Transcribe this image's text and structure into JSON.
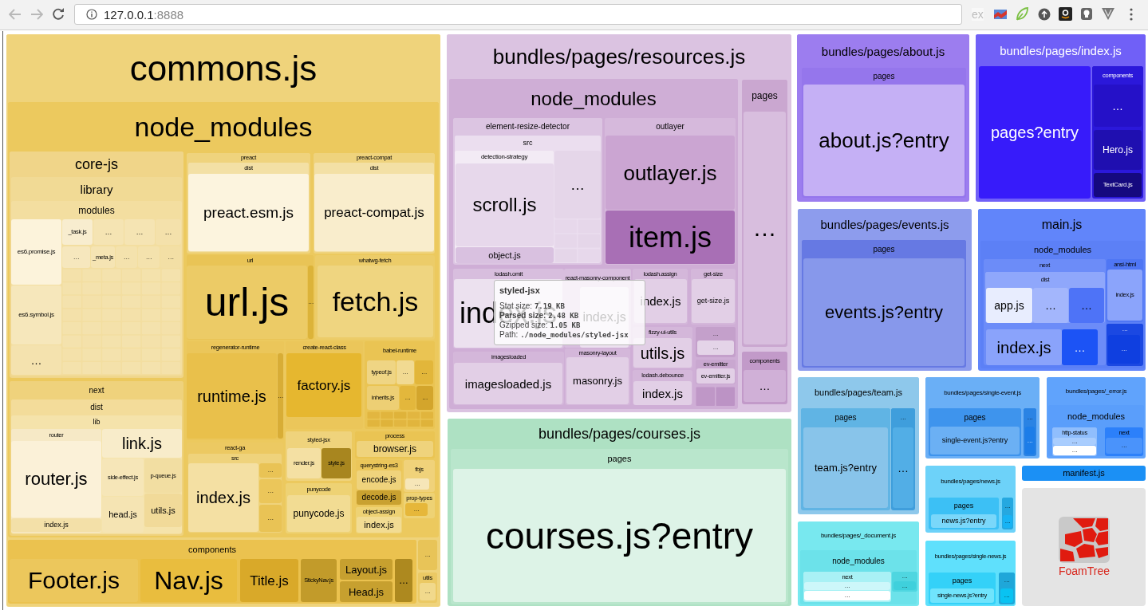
{
  "browser": {
    "url_host": "127.0.0.1",
    "url_port": ":8888",
    "extension_label": "ex"
  },
  "treemap": [
    {
      "label": "commons.js",
      "color": "#efd37b",
      "children": [
        {
          "label": "node_modules",
          "color": "#ecc95e",
          "children": [
            {
              "label": "core-js",
              "color": "#f0d589",
              "children": [
                {
                  "label": "library",
                  "color": "#f1da95",
                  "children": [
                    {
                      "label": "modules",
                      "color": "#f3dea0",
                      "children": [
                        {
                          "label": "es6.promise.js",
                          "color": "#fcf3db"
                        },
                        {
                          "label": "es6.symbol.js",
                          "color": "#f6e7bb"
                        },
                        {
                          "label": "…",
                          "color": "#f4e2ae"
                        },
                        {
                          "label": "_task.js",
                          "color": "#f8edcf"
                        },
                        {
                          "label": "…",
                          "color": "#f5e4b3"
                        },
                        {
                          "label": "…",
                          "color": "#f5e4b3"
                        },
                        {
                          "label": "…",
                          "color": "#f4e1ab"
                        },
                        {
                          "label": "…",
                          "color": "#f6e7bd"
                        },
                        {
                          "label": "_meta.js",
                          "color": "#f5e4b3"
                        },
                        {
                          "label": "…",
                          "color": "#f4e2ad"
                        },
                        {
                          "label": "…",
                          "color": "#f4e2ad"
                        },
                        {
                          "label": "…",
                          "color": "#f3dfa5"
                        }
                      ]
                    }
                  ]
                }
              ]
            },
            {
              "label": "preact",
              "color": "#efd37d",
              "children": [
                {
                  "label": "dist",
                  "color": "#f3e0a5",
                  "children": [
                    {
                      "label": "preact.esm.js",
                      "color": "#fcf4de"
                    }
                  ]
                }
              ]
            },
            {
              "label": "preact-compat",
              "color": "#efd37d",
              "children": [
                {
                  "label": "dist",
                  "color": "#f3e0a5",
                  "children": [
                    {
                      "label": "preact-compat.js",
                      "color": "#f9edcc"
                    }
                  ]
                }
              ]
            },
            {
              "label": "url",
              "color": "#e9c456",
              "children": [
                {
                  "label": "url.js",
                  "color": "#eccb66"
                },
                {
                  "label": "…",
                  "color": "#dcb339"
                }
              ]
            },
            {
              "label": "whatwg-fetch",
              "color": "#eccc69",
              "children": [
                {
                  "label": "fetch.js",
                  "color": "#efd580"
                }
              ]
            },
            {
              "label": "regenerator-runtime",
              "color": "#ebc65a",
              "children": [
                {
                  "label": "runtime.js",
                  "color": "#e9c04b"
                },
                {
                  "label": "…",
                  "color": "#d8ad36"
                }
              ]
            },
            {
              "label": "create-react-class",
              "color": "#ebc65a",
              "children": [
                {
                  "label": "factory.js",
                  "color": "#e6b72f"
                }
              ]
            },
            {
              "label": "babel-runtime",
              "color": "#eac453",
              "children": [
                {
                  "label": "typeof.js",
                  "color": "#efd584"
                },
                {
                  "label": "…",
                  "color": "#f1da92"
                },
                {
                  "label": "…",
                  "color": "#e2b63a"
                },
                {
                  "label": "inherits.js",
                  "color": "#edcf74"
                },
                {
                  "label": "…",
                  "color": "#e3b73c"
                },
                {
                  "label": "…",
                  "color": "#d3a52c"
                }
              ]
            },
            {
              "label": "next",
              "color": "#efd27c",
              "children": [
                {
                  "label": "dist",
                  "color": "#f3dc9a",
                  "children": [
                    {
                      "label": "lib",
                      "color": "#f5e3ab",
                      "children": [
                        {
                          "label": "router",
                          "color": "#f6e9c6",
                          "children": [
                            {
                              "label": "router.js",
                              "color": "#fbf1d8"
                            },
                            {
                              "label": "index.js",
                              "color": "#f3e0a8"
                            }
                          ]
                        },
                        {
                          "label": "link.js",
                          "color": "#f8ecca"
                        },
                        {
                          "label": "side-effect.js",
                          "color": "#f6e6b8"
                        },
                        {
                          "label": "p-queue.js",
                          "color": "#f2dea2"
                        },
                        {
                          "label": "head.js",
                          "color": "#f5e4b3"
                        },
                        {
                          "label": "utils.js",
                          "color": "#f1da99"
                        }
                      ]
                    }
                  ]
                }
              ]
            },
            {
              "label": "react-ga",
              "color": "#ecc962",
              "children": [
                {
                  "label": "src",
                  "color": "#efd37c",
                  "children": [
                    {
                      "label": "index.js",
                      "color": "#f4e0a3"
                    },
                    {
                      "label": "…",
                      "color": "#e9c355"
                    },
                    {
                      "label": "…",
                      "color": "#ebc65a"
                    },
                    {
                      "label": "…",
                      "color": "#e9c355"
                    }
                  ]
                }
              ]
            },
            {
              "label": "styled-jsx",
              "color": "#efd37c",
              "children": [
                {
                  "label": "render.js",
                  "color": "#f4e0a3"
                },
                {
                  "label": "style.js",
                  "color": "#a8861f"
                }
              ]
            },
            {
              "label": "punycode",
              "color": "#eed274",
              "children": [
                {
                  "label": "punycode.js",
                  "color": "#f2dc93"
                }
              ]
            },
            {
              "label": "process",
              "color": "#eac453",
              "children": [
                {
                  "label": "browser.js",
                  "color": "#efd37c"
                }
              ]
            },
            {
              "label": "querystring-es3",
              "color": "#ebc65a",
              "children": [
                {
                  "label": "encode.js",
                  "color": "#efd37c"
                },
                {
                  "label": "decode.js",
                  "color": "#c9a130"
                }
              ]
            },
            {
              "label": "fbjs",
              "color": "#f0d27a",
              "children": [
                {
                  "label": "…",
                  "color": "#f6e6b8"
                }
              ]
            },
            {
              "label": "object-assign",
              "color": "#eed274",
              "children": [
                {
                  "label": "index.js",
                  "color": "#f2dc93"
                }
              ]
            },
            {
              "label": "prop-types",
              "color": "#eed274",
              "children": [
                {
                  "label": "…",
                  "color": "#e6b73a"
                }
              ]
            }
          ]
        },
        {
          "label": "components",
          "color": "#ebc24f",
          "children": [
            {
              "label": "Footer.js",
              "color": "#ecc75c"
            },
            {
              "label": "Nav.js",
              "color": "#e9bd3e"
            },
            {
              "label": "Title.js",
              "color": "#d9a929"
            },
            {
              "label": "StickyNav.js",
              "color": "#c29b2a"
            },
            {
              "label": "Layout.js",
              "color": "#c7a02f"
            },
            {
              "label": "Head.js",
              "color": "#c7a02f"
            },
            {
              "label": "…",
              "color": "#ad891f"
            }
          ]
        },
        {
          "label": "…",
          "color": "#e8c458"
        },
        {
          "label": "utils",
          "color": "#ebc964",
          "children": [
            {
              "label": "…",
              "color": "#f1d98c"
            }
          ]
        }
      ]
    },
    {
      "label": "bundles/pages/resources.js",
      "color": "#dbc3e1",
      "children": [
        {
          "label": "node_modules",
          "color": "#cfaed6",
          "children": [
            {
              "label": "element-resize-detector",
              "color": "#dcc5e2",
              "children": [
                {
                  "label": "src",
                  "color": "#ebdeef",
                  "children": [
                    {
                      "label": "detection-strategy",
                      "color": "#f3ebf5",
                      "children": [
                        {
                          "label": "scroll.js",
                          "color": "#e7d8eb"
                        },
                        {
                          "label": "object.js",
                          "color": "#d9c1e0"
                        }
                      ]
                    },
                    {
                      "label": "…",
                      "color": "#e5d6e9"
                    }
                  ]
                }
              ]
            },
            {
              "label": "outlayer",
              "color": "#d6b9dc",
              "children": [
                {
                  "label": "outlayer.js",
                  "color": "#cba5d2"
                },
                {
                  "label": "item.js",
                  "color": "#a86fb5"
                }
              ]
            },
            {
              "label": "lodash.omit",
              "color": "#d8bede",
              "children": [
                {
                  "label": "index.js",
                  "color": "#ece1ef"
                }
              ]
            },
            {
              "label": "react-masonry-component",
              "color": "#d8bede",
              "children": [
                {
                  "label": "index.js",
                  "color": "#ece1ef"
                }
              ]
            },
            {
              "label": "lodash.assign",
              "color": "#d4b7da",
              "children": [
                {
                  "label": "index.js",
                  "color": "#e2cfe6"
                }
              ]
            },
            {
              "label": "get-size",
              "color": "#d4b7da",
              "children": [
                {
                  "label": "get-size.js",
                  "color": "#e2cfe6"
                }
              ]
            },
            {
              "label": "imagesloaded",
              "color": "#d4b7da",
              "children": [
                {
                  "label": "imagesloaded.js",
                  "color": "#e2cfe6"
                }
              ]
            },
            {
              "label": "masonry-layout",
              "color": "#d4b7da",
              "children": [
                {
                  "label": "masonry.js",
                  "color": "#e2cfe6"
                }
              ]
            },
            {
              "label": "fizzy-ui-utils",
              "color": "#d4b7da",
              "children": [
                {
                  "label": "utils.js",
                  "color": "#e2cfe6"
                }
              ]
            },
            {
              "label": "lodash.debounce",
              "color": "#d4b7da",
              "children": [
                {
                  "label": "index.js",
                  "color": "#e2cfe6"
                }
              ]
            },
            {
              "label": "…",
              "color": "#c4a0cb",
              "children": [
                {
                  "label": "…",
                  "color": "#e4d4e8"
                }
              ]
            },
            {
              "label": "ev-emitter",
              "color": "#c9a7d0",
              "children": [
                {
                  "label": "ev-emitter.js",
                  "color": "#e2cfe6"
                }
              ]
            }
          ]
        },
        {
          "label": "pages",
          "color": "#caa7d0",
          "children": [
            {
              "label": "…",
              "color": "#d8bede"
            }
          ]
        },
        {
          "label": "components",
          "color": "#c29ac9",
          "children": [
            {
              "label": "…",
              "color": "#d0b0d7"
            }
          ]
        }
      ]
    },
    {
      "label": "bundles/pages/courses.js",
      "color": "#aee1c3",
      "children": [
        {
          "label": "pages",
          "color": "#b9e6cc",
          "children": [
            {
              "label": "courses.js?entry",
              "color": "#ddf3e7"
            }
          ]
        }
      ]
    },
    {
      "label": "bundles/pages/about.js",
      "color": "#9c7def",
      "children": [
        {
          "label": "pages",
          "color": "#9576ec",
          "children": [
            {
              "label": "about.js?entry",
              "color": "#c5b0f5"
            }
          ]
        }
      ]
    },
    {
      "label": "bundles/pages/index.js",
      "color": "#7060f7",
      "children": [
        {
          "label": "pages?entry",
          "color": "#371bfa"
        },
        {
          "label": "components",
          "color": "#2b18da",
          "children": [
            {
              "label": "…",
              "color": "#2511c8"
            },
            {
              "label": "Hero.js",
              "color": "#1f0fb0"
            },
            {
              "label": "TextCard.js",
              "color": "#15097f"
            }
          ]
        }
      ]
    },
    {
      "label": "bundles/pages/events.js",
      "color": "#8d9ced",
      "children": [
        {
          "label": "pages",
          "color": "#6679e3",
          "children": [
            {
              "label": "events.js?entry",
              "color": "#8798eb"
            }
          ]
        }
      ]
    },
    {
      "label": "main.js",
      "color": "#6185fa",
      "children": [
        {
          "label": "node_modules",
          "color": "#5c80f6",
          "children": [
            {
              "label": "next",
              "color": "#6c8cf8",
              "children": [
                {
                  "label": "dist",
                  "color": "#8fa7fb",
                  "children": [
                    {
                      "label": "app.js",
                      "color": "#e8edfe"
                    },
                    {
                      "label": "…",
                      "color": "#a3b6fc"
                    },
                    {
                      "label": "…",
                      "color": "#4e73f7"
                    }
                  ]
                },
                {
                  "label": "index.js",
                  "color": "#8aa3fb"
                },
                {
                  "label": "…",
                  "color": "#1c53f5"
                }
              ]
            },
            {
              "label": "ansi-html",
              "color": "#4f76f4",
              "children": [
                {
                  "label": "index.js",
                  "color": "#8ba4fb"
                }
              ]
            },
            {
              "label": "…",
              "color": "#1b48e2",
              "children": [
                {
                  "label": "…",
                  "color": "#0f3fe0"
                }
              ]
            }
          ]
        }
      ]
    },
    {
      "label": "bundles/pages/team.js",
      "color": "#8ec8eb",
      "children": [
        {
          "label": "pages",
          "color": "#60b4e4",
          "children": [
            {
              "label": "team.js?entry",
              "color": "#88c4ea"
            }
          ]
        },
        {
          "label": "…",
          "color": "#3f9edc",
          "children": [
            {
              "label": "…",
              "color": "#52aee6"
            }
          ]
        }
      ]
    },
    {
      "label": "bundles/pages/single-event.js",
      "color": "#6aaff6",
      "children": [
        {
          "label": "pages",
          "color": "#3e94ed",
          "children": [
            {
              "label": "single-event.js?entry",
              "color": "#6bb0f4"
            }
          ]
        },
        {
          "label": "…",
          "color": "#2a83e4",
          "children": [
            {
              "label": "…",
              "color": "#1c7de8"
            }
          ]
        }
      ]
    },
    {
      "label": "bundles/pages/_error.js",
      "color": "#60a3fc",
      "children": [
        {
          "label": "node_modules",
          "color": "#5a9efb",
          "children": [
            {
              "label": "http-status",
              "color": "#90befd",
              "children": [
                {
                  "label": "…",
                  "color": "#a9cdfe"
                },
                {
                  "label": "…",
                  "color": "#ffffff"
                }
              ]
            },
            {
              "label": "next",
              "color": "#2c80fa",
              "children": [
                {
                  "label": "…",
                  "color": "#4a93fb"
                }
              ]
            }
          ]
        }
      ]
    },
    {
      "label": "bundles/pages/_document.js",
      "color": "#78e8ef",
      "children": [
        {
          "label": "node_modules",
          "color": "#6ce2ea",
          "children": [
            {
              "label": "next",
              "color": "#a9f1f5",
              "children": [
                {
                  "label": "…",
                  "color": "#cdf7fa"
                },
                {
                  "label": "…",
                  "color": "#ffffff"
                }
              ]
            },
            {
              "label": "…",
              "color": "#4fd6e0",
              "children": [
                {
                  "label": "…",
                  "color": "#3fd0dc"
                }
              ]
            }
          ]
        }
      ]
    },
    {
      "label": "bundles/pages/news.js",
      "color": "#6dd2f9",
      "children": [
        {
          "label": "pages",
          "color": "#3cc0f5",
          "children": [
            {
              "label": "news.js?entry",
              "color": "#7ad7fa"
            }
          ]
        },
        {
          "label": "…",
          "color": "#25a8e0",
          "children": [
            {
              "label": "…",
              "color": "#17b3f4"
            }
          ]
        }
      ]
    },
    {
      "label": "bundles/pages/single-news.js",
      "color": "#5fe0fc",
      "children": [
        {
          "label": "pages",
          "color": "#34d1f8",
          "children": [
            {
              "label": "single-news.js?entry",
              "color": "#70e4fc"
            }
          ]
        },
        {
          "label": "…",
          "color": "#1fa7d9",
          "children": [
            {
              "label": "…",
              "color": "#09c3f2"
            }
          ]
        }
      ]
    },
    {
      "label": "manifest.js",
      "color": "#1b90f5"
    }
  ],
  "tooltip": {
    "title": "styled-jsx",
    "lines": [
      {
        "label": "Stat size:",
        "value": "7.19 KB",
        "strong": false
      },
      {
        "label": "Parsed size:",
        "value": "2.48 KB",
        "strong": true
      },
      {
        "label": "Gzipped size:",
        "value": "1.05 KB",
        "strong": false
      },
      {
        "label": "Path:",
        "value": "./node_modules/styled-jsx",
        "strong": false
      }
    ]
  },
  "logo": {
    "label": "FoamTree"
  }
}
